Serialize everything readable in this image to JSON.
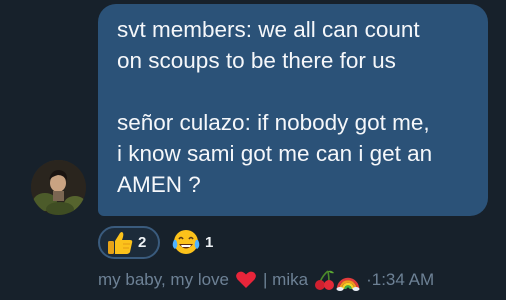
{
  "message": {
    "lines": [
      "svt members: we all can count",
      "on scoups to be there for us",
      "señor culazo: if nobody got me,",
      "i know sami got me can i get an",
      "AMEN ?"
    ]
  },
  "reactions": [
    {
      "emoji": "thumbs-up-icon",
      "count": "2"
    },
    {
      "emoji": "face-with-tears-of-joy-icon",
      "count": "1"
    }
  ],
  "meta": {
    "sender_name": "my baby, my love",
    "separator": "| mika",
    "timestamp": "1:34 AM",
    "time_dot": "·"
  },
  "colors": {
    "background": "#17212b",
    "bubble": "#2b5278",
    "message_text": "#f5f7fa",
    "meta_text": "#6d8195",
    "reaction_border": "#3a5b7d"
  }
}
